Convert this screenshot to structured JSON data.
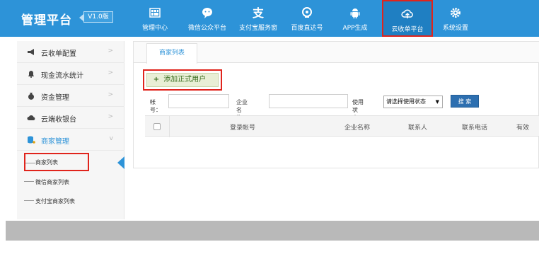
{
  "header": {
    "brand": "管理平台",
    "version": "V1.0版",
    "nav": [
      {
        "label": "管理中心",
        "icon": "dashboard-icon"
      },
      {
        "label": "微信公众平台",
        "icon": "wechat-icon"
      },
      {
        "label": "支付宝服务窗",
        "icon": "alipay-icon"
      },
      {
        "label": "百度直达号",
        "icon": "baidu-icon"
      },
      {
        "label": "APP生成",
        "icon": "android-icon"
      },
      {
        "label": "云收单平台",
        "icon": "cloud-upload-icon",
        "active": true
      },
      {
        "label": "系统设置",
        "icon": "gear-icon"
      }
    ]
  },
  "sidebar": {
    "items": [
      {
        "label": "云收单配置",
        "icon": "megaphone-icon"
      },
      {
        "label": "现金流水统计",
        "icon": "bell-icon"
      },
      {
        "label": "资金管理",
        "icon": "money-bag-icon"
      },
      {
        "label": "云端收银台",
        "icon": "cloud-icon"
      },
      {
        "label": "商家管理",
        "icon": "database-icon",
        "open": true
      }
    ],
    "sub_items": [
      {
        "label": "商家列表",
        "current": true
      },
      {
        "label": "微信商家列表"
      },
      {
        "label": "支付宝商家列表"
      }
    ]
  },
  "main": {
    "tab": "商家列表",
    "add_button": "添加正式用户",
    "search": {
      "account_label": "帐号：",
      "company_label": "企业名称：",
      "status_label": "使用状态：",
      "status_value": "请选择使用状态",
      "search_button": "搜 索"
    },
    "table": {
      "columns": [
        "登录帐号",
        "企业名称",
        "联系人",
        "联系电话",
        "有效"
      ]
    }
  },
  "colors": {
    "header_bg": "#2d93d8",
    "highlight_border": "#e0241c",
    "accent": "#2d93d8"
  }
}
